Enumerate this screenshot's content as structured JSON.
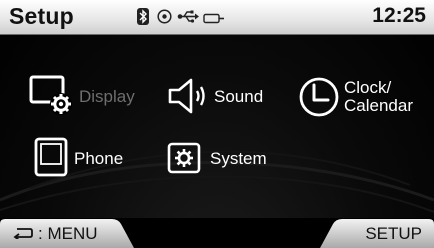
{
  "statusbar": {
    "title": "Setup",
    "time": "12:25",
    "icons": [
      "bluetooth-icon",
      "disc-icon",
      "usb-icon",
      "aux-icon"
    ]
  },
  "menu": {
    "items": [
      {
        "id": "display",
        "label": "Display",
        "icon": "display-settings-icon",
        "enabled": false
      },
      {
        "id": "sound",
        "label": "Sound",
        "icon": "speaker-icon",
        "enabled": true
      },
      {
        "id": "clock",
        "label": "Clock/\nCalendar",
        "icon": "clock-icon",
        "enabled": true
      },
      {
        "id": "phone",
        "label": "Phone",
        "icon": "phone-icon",
        "enabled": true
      },
      {
        "id": "system",
        "label": "System",
        "icon": "system-gear-icon",
        "enabled": true
      }
    ]
  },
  "bottombar": {
    "menu_label": ": MENU",
    "setup_label": "SETUP"
  }
}
